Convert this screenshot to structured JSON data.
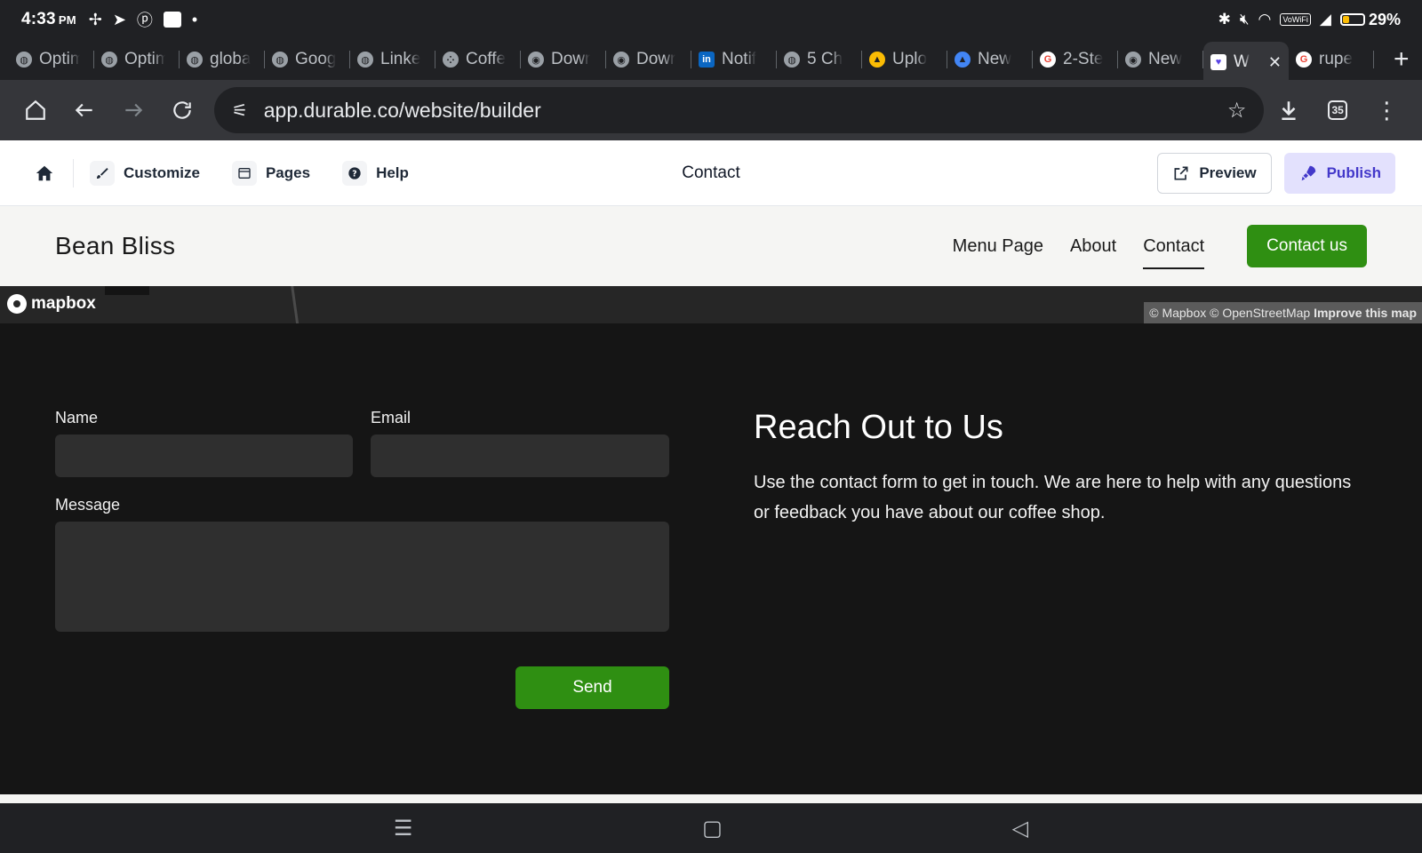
{
  "status_bar": {
    "time": "4:33",
    "ampm": "PM",
    "battery": "29%",
    "battery_level": 0.29,
    "vowifi": "VoWiFi"
  },
  "tabs": [
    {
      "label": "Optim",
      "icon": "globe-icon"
    },
    {
      "label": "Optim",
      "icon": "globe-icon"
    },
    {
      "label": "global",
      "icon": "globe-icon"
    },
    {
      "label": "Googl",
      "icon": "globe-icon"
    },
    {
      "label": "Linke",
      "icon": "globe-icon"
    },
    {
      "label": "Coffe",
      "icon": "dots-icon"
    },
    {
      "label": "Dowr",
      "icon": "chrome-icon"
    },
    {
      "label": "Dowr",
      "icon": "chrome-icon"
    },
    {
      "label": "Notif",
      "icon": "linkedin-icon"
    },
    {
      "label": "5 Ch",
      "icon": "globe-icon"
    },
    {
      "label": "Uplo",
      "icon": "upload-icon"
    },
    {
      "label": "New",
      "icon": "google-ads-icon"
    },
    {
      "label": "2-Ste",
      "icon": "google-icon"
    },
    {
      "label": "New",
      "icon": "chrome-icon"
    },
    {
      "label": "W",
      "icon": "durable-icon",
      "active": true
    },
    {
      "label": "rupe",
      "icon": "google-icon"
    }
  ],
  "omnibox": {
    "url": "app.durable.co/website/builder",
    "tab_count": "35"
  },
  "builder_bar": {
    "customize": "Customize",
    "pages": "Pages",
    "help": "Help",
    "page_title": "Contact",
    "preview": "Preview",
    "publish": "Publish"
  },
  "site": {
    "brand": "Bean Bliss",
    "nav": [
      "Menu Page",
      "About",
      "Contact"
    ],
    "cta": "Contact us",
    "accent": "#2f8f12"
  },
  "map": {
    "logo_text": "mapbox",
    "attribution": "© Mapbox © OpenStreetMap",
    "improve": "Improve this map"
  },
  "contact_form": {
    "name_label": "Name",
    "email_label": "Email",
    "message_label": "Message",
    "send": "Send",
    "heading": "Reach Out to Us",
    "body": "Use the contact form to get in touch. We are here to help with any questions or feedback you have about our coffee shop."
  }
}
